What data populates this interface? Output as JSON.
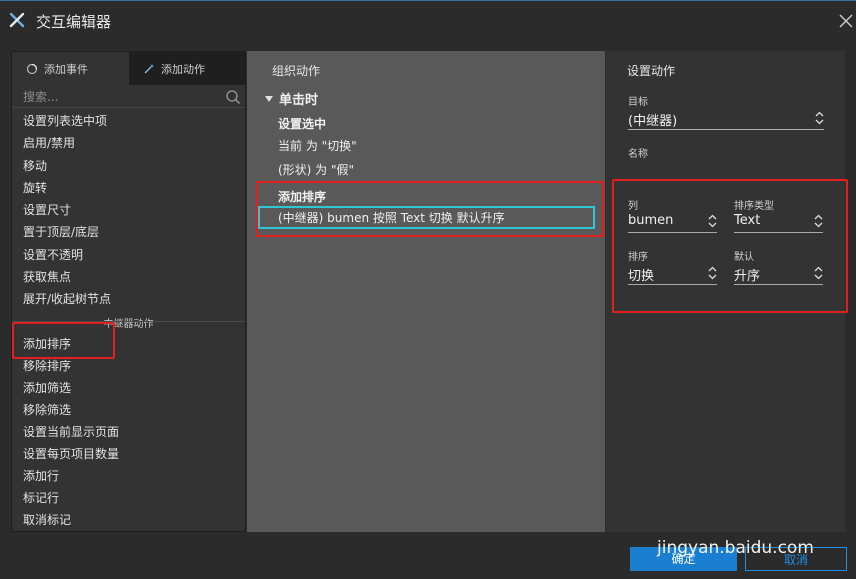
{
  "window": {
    "title": "交互编辑器"
  },
  "left": {
    "tabs": [
      {
        "label": "添加事件",
        "icon": "event-icon"
      },
      {
        "label": "添加动作",
        "icon": "magic-icon"
      }
    ],
    "search_placeholder": "搜索...",
    "actions": [
      "设置列表选中项",
      "启用/禁用",
      "移动",
      "旋转",
      "设置尺寸",
      "置于顶层/底层",
      "设置不透明",
      "获取焦点",
      "展开/收起树节点"
    ],
    "group_label": "中继器动作",
    "repeater_actions": [
      "添加排序",
      "移除排序",
      "添加筛选",
      "移除筛选",
      "设置当前显示页面",
      "设置每页项目数量",
      "添加行",
      "标记行",
      "取消标记"
    ]
  },
  "middle": {
    "title": "组织动作",
    "event": "单击时",
    "case1_title": "设置选中",
    "case1_lines": [
      "当前 为 \"切换\"",
      "(形状) 为 \"假\""
    ],
    "case2_title": "添加排序",
    "case2_line": "(中继器) bumen 按照 Text 切换 默认升序"
  },
  "right": {
    "title": "设置动作",
    "target_label": "目标",
    "target_value": "(中继器)",
    "name_label": "名称",
    "col_label": "列",
    "col_value": "bumen",
    "sort_type_label": "排序类型",
    "sort_type_value": "Text",
    "order_label": "排序",
    "order_value": "切换",
    "default_label": "默认",
    "default_value": "升序"
  },
  "buttons": {
    "ok": "确定",
    "cancel": "取消"
  },
  "watermark": "jingyan.baidu.com",
  "colors": {
    "accent": "#1b7fd1",
    "highlight_red": "#e0201e",
    "highlight_cyan": "#30c6d6"
  }
}
